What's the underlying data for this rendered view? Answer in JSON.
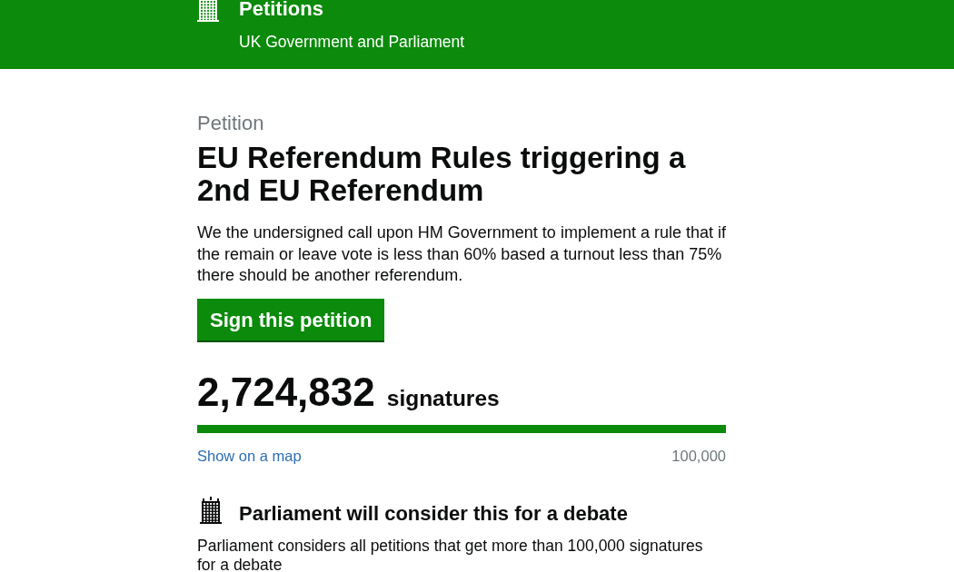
{
  "header": {
    "title": "Petitions",
    "subtitle": "UK Government and Parliament"
  },
  "petition": {
    "label": "Petition",
    "title": "EU Referendum Rules triggering a 2nd EU Referendum",
    "description": "We the undersigned call upon HM Government to implement a rule that if the remain or leave vote is less than 60% based a turnout less than 75% there should be another referendum.",
    "sign_button": "Sign this petition",
    "signature_count": "2,724,832",
    "signature_label": "signatures",
    "progress": {
      "level": 1
    },
    "map_link": "Show on a map",
    "threshold": "100,000"
  },
  "debate_notice": {
    "heading": "Parliament will consider this for a debate",
    "text": "Parliament considers all petitions that get more than 100,000 signatures for a debate"
  }
}
